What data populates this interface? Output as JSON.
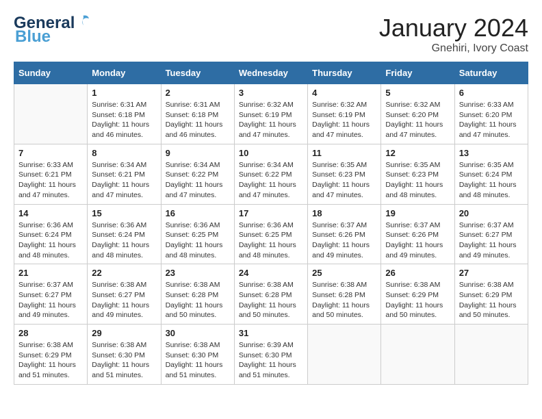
{
  "header": {
    "logo_general": "General",
    "logo_blue": "Blue",
    "month_title": "January 2024",
    "location": "Gnehiri, Ivory Coast"
  },
  "days_of_week": [
    "Sunday",
    "Monday",
    "Tuesday",
    "Wednesday",
    "Thursday",
    "Friday",
    "Saturday"
  ],
  "weeks": [
    [
      {
        "day": "",
        "info": ""
      },
      {
        "day": "1",
        "info": "Sunrise: 6:31 AM\nSunset: 6:18 PM\nDaylight: 11 hours and 46 minutes."
      },
      {
        "day": "2",
        "info": "Sunrise: 6:31 AM\nSunset: 6:18 PM\nDaylight: 11 hours and 46 minutes."
      },
      {
        "day": "3",
        "info": "Sunrise: 6:32 AM\nSunset: 6:19 PM\nDaylight: 11 hours and 47 minutes."
      },
      {
        "day": "4",
        "info": "Sunrise: 6:32 AM\nSunset: 6:19 PM\nDaylight: 11 hours and 47 minutes."
      },
      {
        "day": "5",
        "info": "Sunrise: 6:32 AM\nSunset: 6:20 PM\nDaylight: 11 hours and 47 minutes."
      },
      {
        "day": "6",
        "info": "Sunrise: 6:33 AM\nSunset: 6:20 PM\nDaylight: 11 hours and 47 minutes."
      }
    ],
    [
      {
        "day": "7",
        "info": "Sunrise: 6:33 AM\nSunset: 6:21 PM\nDaylight: 11 hours and 47 minutes."
      },
      {
        "day": "8",
        "info": "Sunrise: 6:34 AM\nSunset: 6:21 PM\nDaylight: 11 hours and 47 minutes."
      },
      {
        "day": "9",
        "info": "Sunrise: 6:34 AM\nSunset: 6:22 PM\nDaylight: 11 hours and 47 minutes."
      },
      {
        "day": "10",
        "info": "Sunrise: 6:34 AM\nSunset: 6:22 PM\nDaylight: 11 hours and 47 minutes."
      },
      {
        "day": "11",
        "info": "Sunrise: 6:35 AM\nSunset: 6:23 PM\nDaylight: 11 hours and 47 minutes."
      },
      {
        "day": "12",
        "info": "Sunrise: 6:35 AM\nSunset: 6:23 PM\nDaylight: 11 hours and 48 minutes."
      },
      {
        "day": "13",
        "info": "Sunrise: 6:35 AM\nSunset: 6:24 PM\nDaylight: 11 hours and 48 minutes."
      }
    ],
    [
      {
        "day": "14",
        "info": "Sunrise: 6:36 AM\nSunset: 6:24 PM\nDaylight: 11 hours and 48 minutes."
      },
      {
        "day": "15",
        "info": "Sunrise: 6:36 AM\nSunset: 6:24 PM\nDaylight: 11 hours and 48 minutes."
      },
      {
        "day": "16",
        "info": "Sunrise: 6:36 AM\nSunset: 6:25 PM\nDaylight: 11 hours and 48 minutes."
      },
      {
        "day": "17",
        "info": "Sunrise: 6:36 AM\nSunset: 6:25 PM\nDaylight: 11 hours and 48 minutes."
      },
      {
        "day": "18",
        "info": "Sunrise: 6:37 AM\nSunset: 6:26 PM\nDaylight: 11 hours and 49 minutes."
      },
      {
        "day": "19",
        "info": "Sunrise: 6:37 AM\nSunset: 6:26 PM\nDaylight: 11 hours and 49 minutes."
      },
      {
        "day": "20",
        "info": "Sunrise: 6:37 AM\nSunset: 6:27 PM\nDaylight: 11 hours and 49 minutes."
      }
    ],
    [
      {
        "day": "21",
        "info": "Sunrise: 6:37 AM\nSunset: 6:27 PM\nDaylight: 11 hours and 49 minutes."
      },
      {
        "day": "22",
        "info": "Sunrise: 6:38 AM\nSunset: 6:27 PM\nDaylight: 11 hours and 49 minutes."
      },
      {
        "day": "23",
        "info": "Sunrise: 6:38 AM\nSunset: 6:28 PM\nDaylight: 11 hours and 50 minutes."
      },
      {
        "day": "24",
        "info": "Sunrise: 6:38 AM\nSunset: 6:28 PM\nDaylight: 11 hours and 50 minutes."
      },
      {
        "day": "25",
        "info": "Sunrise: 6:38 AM\nSunset: 6:28 PM\nDaylight: 11 hours and 50 minutes."
      },
      {
        "day": "26",
        "info": "Sunrise: 6:38 AM\nSunset: 6:29 PM\nDaylight: 11 hours and 50 minutes."
      },
      {
        "day": "27",
        "info": "Sunrise: 6:38 AM\nSunset: 6:29 PM\nDaylight: 11 hours and 50 minutes."
      }
    ],
    [
      {
        "day": "28",
        "info": "Sunrise: 6:38 AM\nSunset: 6:29 PM\nDaylight: 11 hours and 51 minutes."
      },
      {
        "day": "29",
        "info": "Sunrise: 6:38 AM\nSunset: 6:30 PM\nDaylight: 11 hours and 51 minutes."
      },
      {
        "day": "30",
        "info": "Sunrise: 6:38 AM\nSunset: 6:30 PM\nDaylight: 11 hours and 51 minutes."
      },
      {
        "day": "31",
        "info": "Sunrise: 6:39 AM\nSunset: 6:30 PM\nDaylight: 11 hours and 51 minutes."
      },
      {
        "day": "",
        "info": ""
      },
      {
        "day": "",
        "info": ""
      },
      {
        "day": "",
        "info": ""
      }
    ]
  ]
}
